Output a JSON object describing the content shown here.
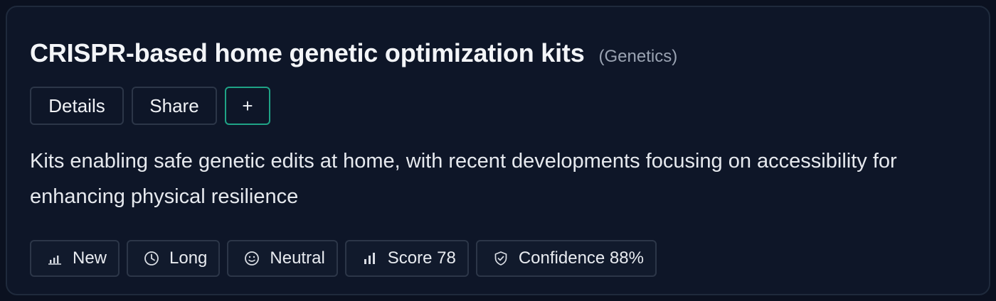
{
  "card": {
    "title": "CRISPR-based home genetic optimization kits",
    "category": "(Genetics)",
    "description": "Kits enabling safe genetic edits at home, with recent developments focusing on accessibility for enhancing physical resilience"
  },
  "actions": {
    "details_label": "Details",
    "share_label": "Share",
    "add_label": "+"
  },
  "tags": [
    {
      "icon": "bar-chart-icon",
      "label": "New"
    },
    {
      "icon": "clock-icon",
      "label": "Long"
    },
    {
      "icon": "smiley-icon",
      "label": "Neutral"
    },
    {
      "icon": "signal-bars-icon",
      "label": "Score 78"
    },
    {
      "icon": "shield-check-icon",
      "label": "Confidence 88%"
    }
  ],
  "colors": {
    "background": "#0b1120",
    "card": "#0e1628",
    "border": "#2c3648",
    "accent": "#1fa386"
  }
}
